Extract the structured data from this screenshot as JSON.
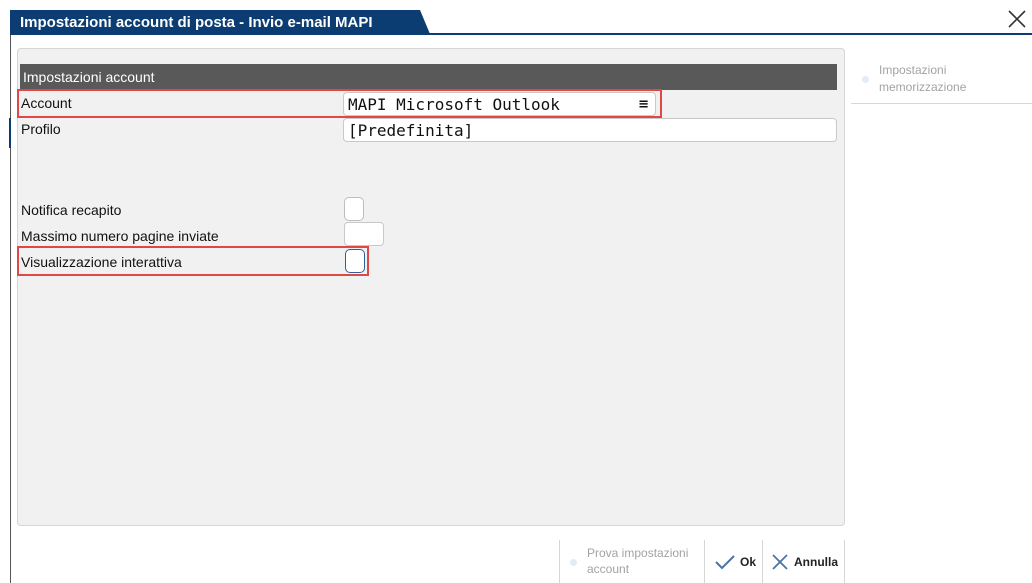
{
  "window": {
    "title": "Impostazioni account di posta - Invio e-mail MAPI"
  },
  "section": {
    "title": "Impostazioni account"
  },
  "fields": {
    "account": {
      "label": "Account",
      "value": "MAPI Microsoft Outlook",
      "menu_icon": "≡"
    },
    "profilo": {
      "label": "Profilo",
      "value": "[Predefinita]"
    },
    "notifica": {
      "label": "Notifica recapito",
      "checked": false
    },
    "massimo": {
      "label": "Massimo numero pagine inviate",
      "value": ""
    },
    "visualizzazione": {
      "label": "Visualizzazione interattiva",
      "checked": false
    }
  },
  "sidebar": {
    "items": [
      {
        "label_line1": "Impostazioni",
        "label_line2": "memorizzazione",
        "enabled": false
      }
    ]
  },
  "footer": {
    "test_button": {
      "line1": "Prova impostazioni",
      "line2": "account",
      "enabled": false
    },
    "ok_button": {
      "label": "Ok"
    },
    "cancel_button": {
      "label": "Annulla"
    }
  },
  "colors": {
    "title_bar": "#0b3d73",
    "section_header": "#595959",
    "highlight": "#e04848",
    "panel_bg": "#f1f1f1"
  }
}
